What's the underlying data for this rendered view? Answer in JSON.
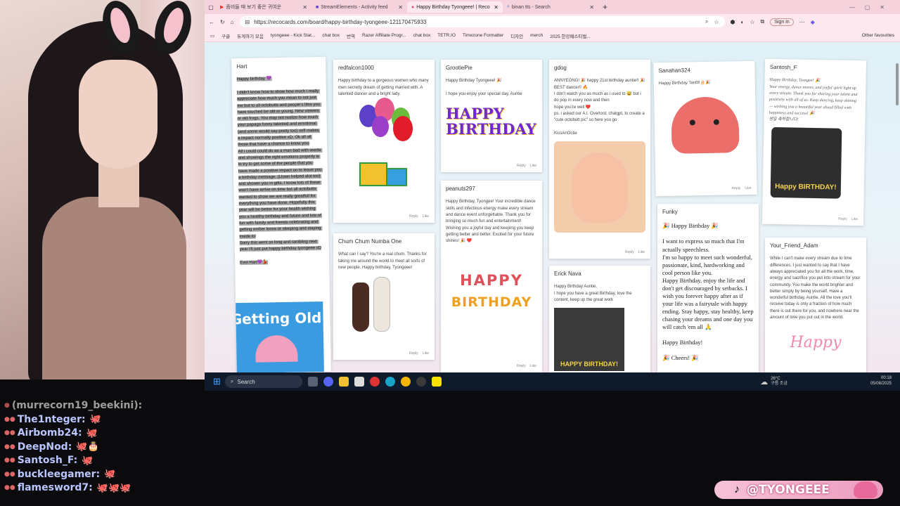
{
  "browser": {
    "tabs": [
      {
        "label": "좀비들 때 보기 좋은 귀여운",
        "icon": "youtube-icon"
      },
      {
        "label": "StreamElements - Activity feed",
        "icon": "streamelements-icon"
      },
      {
        "label": "Happy Birthday Tyongeee! | Reco",
        "icon": "recocards-icon",
        "active": true
      },
      {
        "label": "binan tts - Search",
        "icon": "search-icon"
      }
    ],
    "new_tab": "+",
    "url": "https://recocards.com/board/happy-birthday-tyongeee-121170475933",
    "signin": "Sign in",
    "bookmarks": [
      "구글",
      "듀게하기 모음",
      "tyongeee - Kick Stat...",
      "chat box",
      "번역",
      "Razer Affiliate Progr...",
      "chat box",
      "TETR.IO",
      "Timezone Formatter",
      "디자인",
      "merch",
      "2025 한강페스티벌..."
    ],
    "other_favourites": "Other favourites"
  },
  "cards": [
    {
      "name": "Hart",
      "message": "Happy birthday 💜\n\nI didn't know how to show how much i really appreciate how much you mean to not just me but to all octobutts and people's lifes you have touched be old or young. New viewers or old frogs. You may not realize how much your papaga funny talented and emotional (and some would say pretty too) self makes a impact normally positive xD. Ok all all those that have a chance to know you.\nAll i could could do as a man bad with words and showings the right emotions properly is to try to get some of the people that you have made a positive impact on to leave you a birthday message. (Llown helped alot too) and shower you in gifts. I know lots of these won't have arrive on time but all actobutts wanted to show we are really greatfull for everything you have done. Hopefully this year will be better for your health wishing you a healthy birthday and future and lots of fun with family and friends celebrating and getting ember loons or sleeping and staying inside lol\nSorry this went so long and rambling next year I'll just put happy birthday tyongeee xD\n\nEvol Hart💜💃",
      "sticker": "Getting Old"
    },
    {
      "name": "redfalcon1000",
      "message": "Happy birthday to a gorgeous women who many men secretly dream of getting married with. A talented dancer and a bright lady."
    },
    {
      "name": "Chum Chum Numba One",
      "message": "What can I say? You're a real chum. Thanks for taking me around the world to meet all sorts of new people. Happy birthday, Tyongeee!"
    },
    {
      "name": "GrootiePie",
      "message": "Happy Birthday Tyongeee! 🎉\n\nI hope you enjoy your special day, Auntie",
      "sticker": "HAPPY BIRTHDAY"
    },
    {
      "name": "peanuts297",
      "message": "Happy Birthday, Tyongee! Your incredible dance skills and infectious energy make every stream and dance event unforgettable. Thank you for bringing so much fun and entertainment! Wishing you a joyful day and keeping you keep getting better and better. Excited for your future shines! 🎉 ❤️",
      "sticker_lines": [
        "HAPPY",
        "BIRTHDAY"
      ]
    },
    {
      "name": "gdog",
      "message": "ANNYEONG! 🎉 happy 21st birthday auntie!! 🎉 BEST dancer!! 🔥\nI don't watch you as much as i used to 😅 but i do pop in every now and then\nhope you're well ❤️\nps. i asked our A.I. Overlord, chatgpt, to create a \"cute octobutt pic\" so here you go\n\nKissAnOctie"
    },
    {
      "name": "Erick Nava",
      "message": "Happy Birthday Auntie,\nI hope you have a great Birthday, love the content, keep up the great work",
      "gif_text": "HAPPY BIRTHDAY!"
    },
    {
      "name": "Sanahan324",
      "message": "Happy Birthday Tan0l!🎂🎉"
    },
    {
      "name": "Funky",
      "message": "🎉 Happy Birthday 🎉\n\nI want to express so much that I'm actually speechless.\nI'm so happy to meet such wonderful, passionate, kind, hardworking and cool person like you.\nHappy Birthday, enjoy the life and don't get discouraged by setbacks. I wish you forever happy after as if your life was a fairytale with happy ending. Stay happy, stay healthy, keep chasing your dreams and one day you will catch 'em all 🙏\n\nHappy Birthday!\n\n🎉 Cheers! 🎉"
    },
    {
      "name": "Santosh_F",
      "message": "Happy Birthday, Tyongee! 🎉\nYour energy, dance moves, and joyful spirit light up every stream. Thank you for sharing your talent and positivity with all of us. Keep dancing, keep shining — wishing you a beautiful year ahead filled with happiness and success! 🎉\n생일 축하합니다!",
      "gif_text": "Happy BIRTHDAY!"
    },
    {
      "name": "Your_Friend_Adam",
      "message": "While I can't make every stream due to time differences, I just wanted to say that I have always appreciated you for all the work, time, energy and sacrifice you put into stream for your community. You make the world brighter and better simply by being yourself. Have a wonderful birthday, Auntie. All the love you'll receive today is only a fraction of how much there is out there for you, and nowhere near the amount of love you put out in the world.",
      "script_text": "Happy"
    }
  ],
  "card_actions": {
    "reply": "Reply",
    "like": "Like"
  },
  "taskbar": {
    "search": "Search",
    "weather_temp": "26°C",
    "weather_desc": "구름 조금",
    "time": "00:18",
    "date": "05/08/2025"
  },
  "chat": [
    {
      "user": "(murrecorn19_beekini):",
      "faded": true
    },
    {
      "user": "The1nteger:",
      "emote": "🐙"
    },
    {
      "user": "Airbomb24:",
      "emote": "🐙"
    },
    {
      "user": "DeepNod:",
      "emote": "🐙🎂"
    },
    {
      "user": "Santosh_F:",
      "emote": "🐙"
    },
    {
      "user": "buckleegamer:",
      "emote": "🐙"
    },
    {
      "user": "flamesword7:",
      "emote": "🐙🐙🐙"
    }
  ],
  "overlay": {
    "tiktok_handle": "@TYONGEEE"
  },
  "colors": {
    "browser_chrome": "#f6d2dd",
    "card_bg": "#ffffff",
    "chat_name": "#b9c6ff",
    "tiktok_pill": "#ec9cc0",
    "taskbar": "#0f1a2b"
  }
}
